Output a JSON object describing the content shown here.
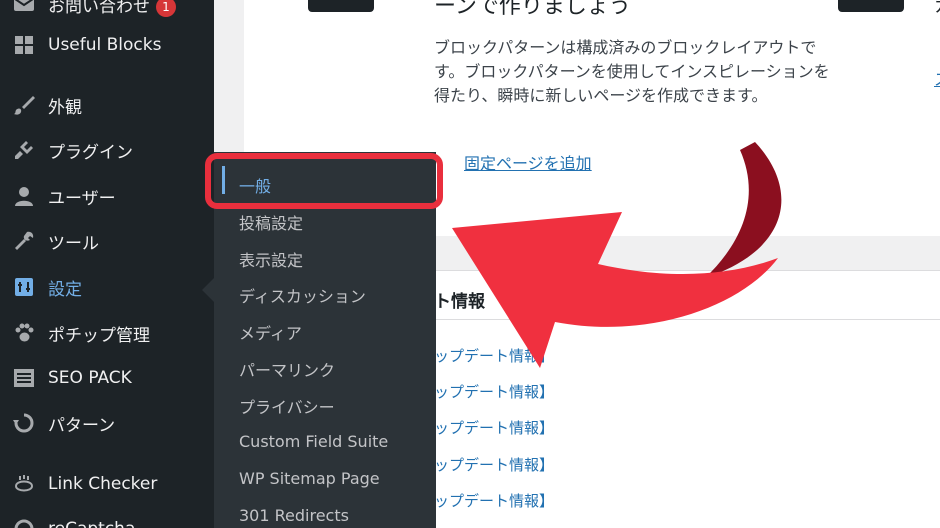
{
  "sidebar": {
    "items": [
      {
        "name": "contact",
        "label": "お問い合わせ",
        "badge": "1",
        "icon": "mail-icon"
      },
      {
        "name": "useful-blocks",
        "label": "Useful Blocks",
        "icon": "blocks-icon"
      },
      {
        "name": "appearance",
        "label": "外観",
        "icon": "paintbrush-icon"
      },
      {
        "name": "plugins",
        "label": "プラグイン",
        "icon": "plugin-icon"
      },
      {
        "name": "users",
        "label": "ユーザー",
        "icon": "user-icon"
      },
      {
        "name": "tools",
        "label": "ツール",
        "icon": "wrench-icon"
      },
      {
        "name": "settings",
        "label": "設定",
        "icon": "settings-icon",
        "active": true
      },
      {
        "name": "pochipp",
        "label": "ポチップ管理",
        "icon": "paw-icon"
      },
      {
        "name": "seo-pack",
        "label": "SEO PACK",
        "icon": "list-icon"
      },
      {
        "name": "patterns",
        "label": "パターン",
        "icon": "refresh-icon"
      },
      {
        "name": "link-checker",
        "label": "Link Checker",
        "icon": "link-checker-icon"
      },
      {
        "name": "recaptcha",
        "label": "reCaptcha",
        "icon": "recaptcha-icon"
      }
    ]
  },
  "submenu": {
    "items": [
      {
        "label": "一般",
        "current": true
      },
      {
        "label": "投稿設定"
      },
      {
        "label": "表示設定"
      },
      {
        "label": "ディスカッション"
      },
      {
        "label": "メディア"
      },
      {
        "label": "パーマリンク"
      },
      {
        "label": "プライバシー"
      },
      {
        "label": "Custom Field Suite"
      },
      {
        "label": "WP Sitemap Page"
      },
      {
        "label": "301 Redirects"
      }
    ]
  },
  "card": {
    "heading": "ーンで作りましょう",
    "description": "ブロックパターンは構成済みのブロックレイアウトです。ブロックパターンを使用してインスピレーションを得たり、瞬時に新しいページを作成できます。",
    "link": "固定ページを追加",
    "right_char": "カ",
    "right_link": "ス"
  },
  "news": {
    "title": "ト情報",
    "items": [
      "ップデート情報】",
      "ップデート情報】",
      "ップデート情報】",
      "ップデート情報】",
      "ップデート情報】"
    ]
  },
  "colors": {
    "sidebar_bg": "#1d2327",
    "submenu_bg": "#2c3338",
    "accent": "#72aee6",
    "link": "#2271b1",
    "annotation_red": "#e92f3d",
    "badge_red": "#d63638"
  }
}
